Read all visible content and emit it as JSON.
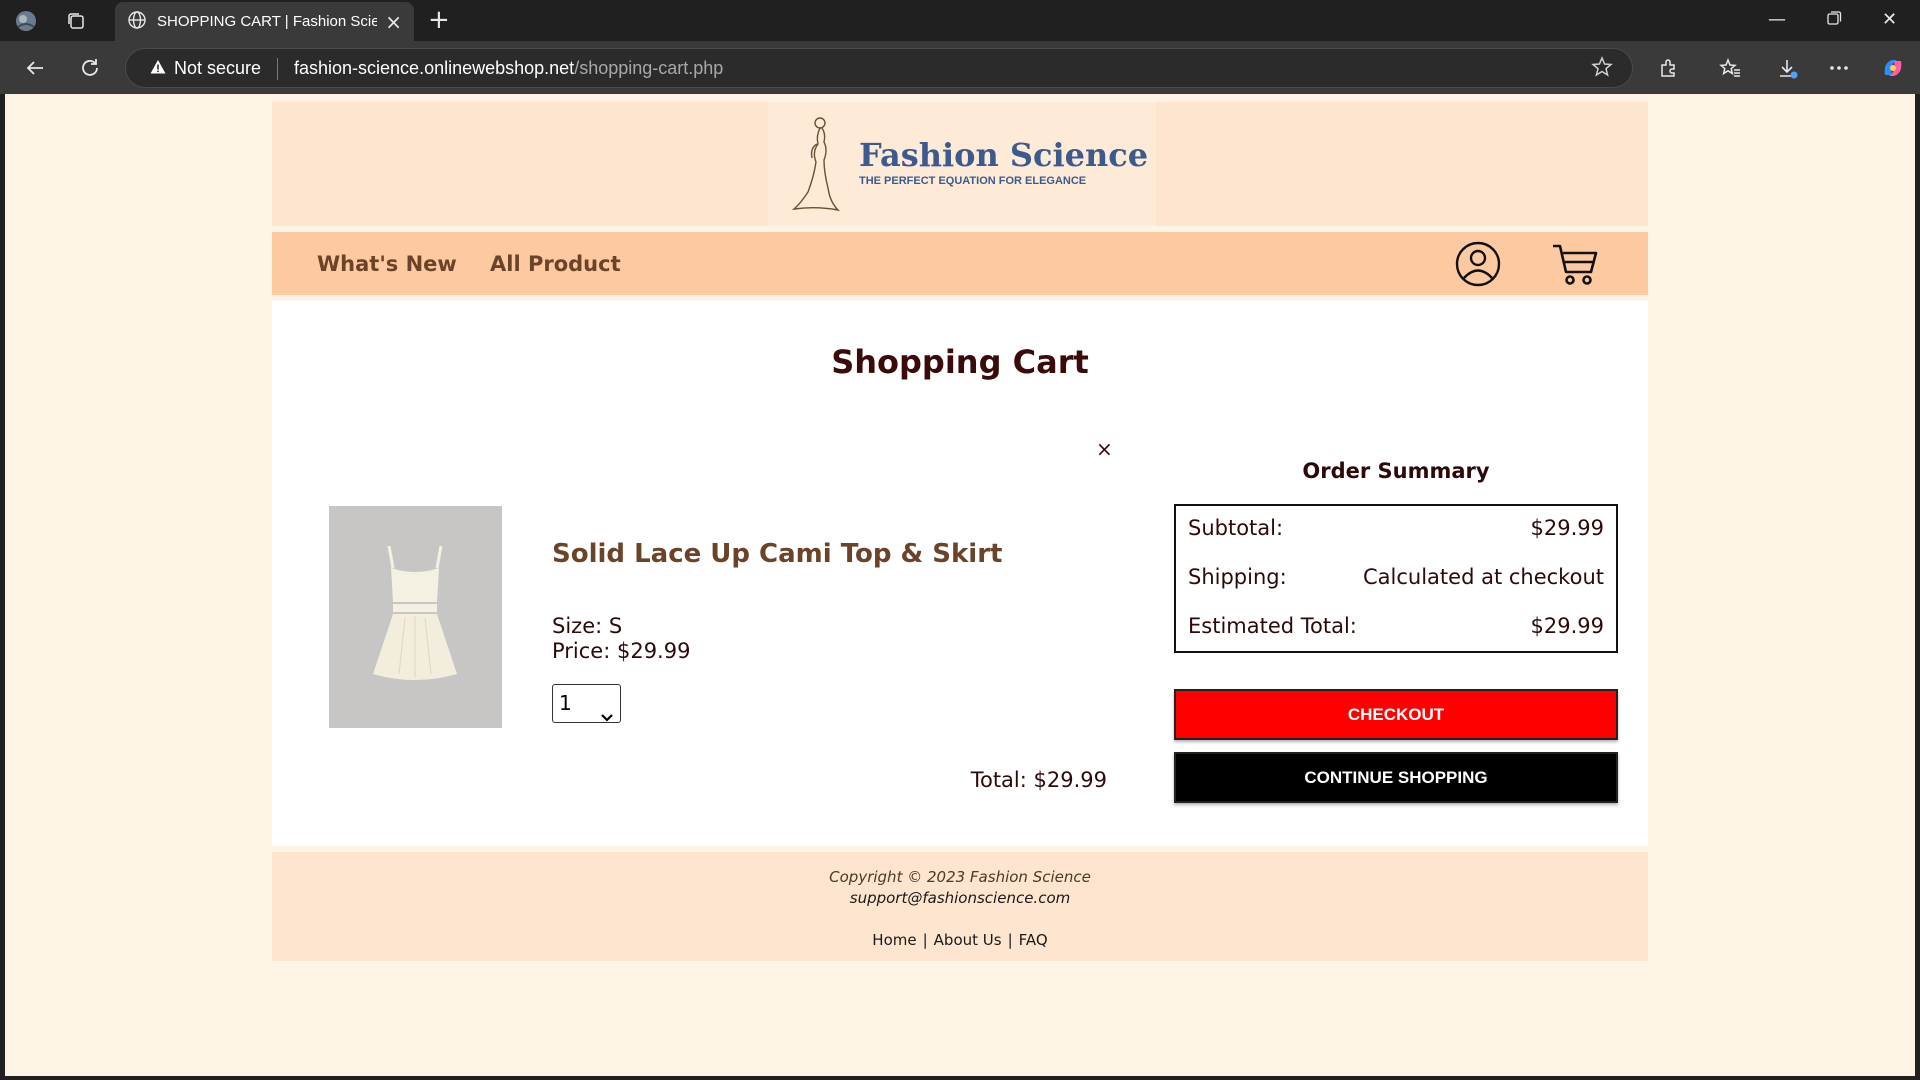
{
  "browser": {
    "tab_title": "SHOPPING CART | Fashion Science",
    "security_label": "Not secure",
    "url_domain": "fashion-science.onlinewebshop.net",
    "url_path": "/shopping-cart.php"
  },
  "site": {
    "logo_name": "Fashion Science",
    "logo_tagline": "THE PERFECT EQUATION FOR ELEGANCE",
    "nav": {
      "whats_new": "What's New",
      "all_product": "All Product"
    }
  },
  "cart": {
    "title": "Shopping Cart",
    "remove_symbol": "×",
    "item": {
      "name": "Solid Lace Up Cami Top & Skirt",
      "size": "Size: S",
      "price": "Price: $29.99",
      "quantity": "1",
      "total": "Total: $29.99"
    }
  },
  "summary": {
    "title": "Order Summary",
    "rows": [
      {
        "label": "Subtotal:",
        "value": "$29.99"
      },
      {
        "label": "Shipping:",
        "value": "Calculated at checkout"
      },
      {
        "label": "Estimated Total:",
        "value": "$29.99"
      }
    ],
    "checkout_label": "CHECKOUT",
    "continue_label": "CONTINUE SHOPPING",
    "checkout_color": "#ff0000",
    "continue_color": "#000000"
  },
  "footer": {
    "copyright": "Copyright © 2023 Fashion Science",
    "email": "support@fashionscience.com",
    "links": [
      "Home",
      "About Us",
      "FAQ"
    ]
  },
  "icons": [
    "globe-icon",
    "tabs-icon",
    "back-icon",
    "refresh-icon",
    "warning-icon",
    "star-icon",
    "extensions-icon",
    "favorites-icon",
    "downloads-icon",
    "more-icon",
    "copilot-icon",
    "account-icon",
    "cart-icon",
    "chevron-down-icon"
  ]
}
